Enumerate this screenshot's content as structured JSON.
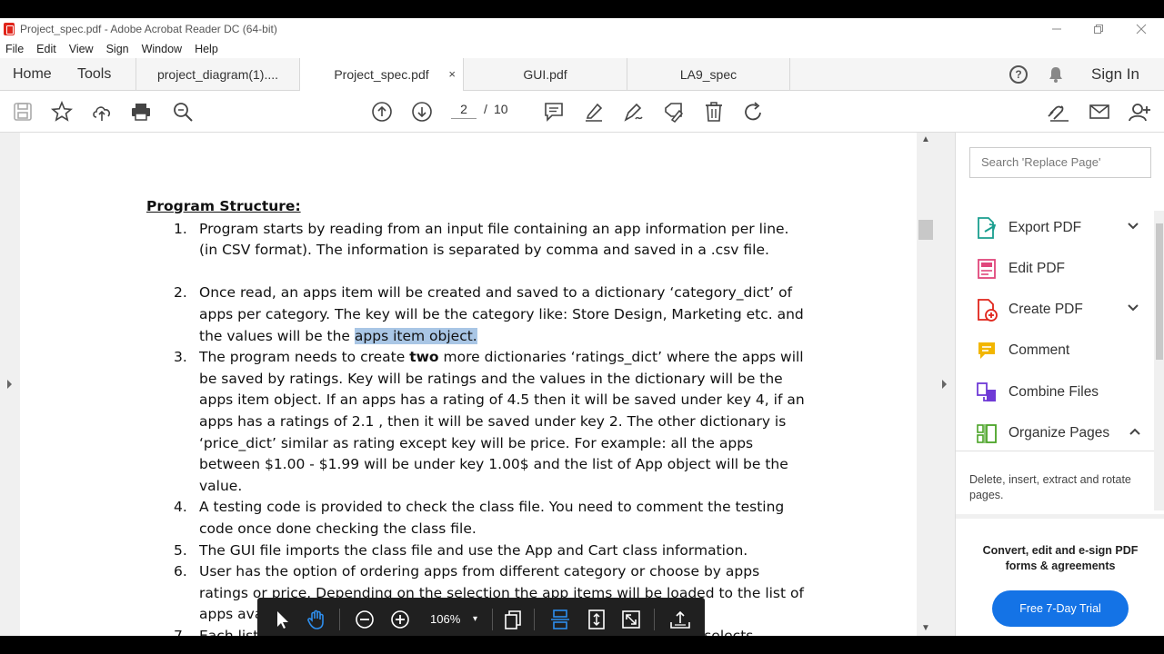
{
  "window": {
    "title": "Project_spec.pdf - Adobe Acrobat Reader DC (64-bit)",
    "controls": [
      "minimize",
      "restore",
      "close"
    ]
  },
  "menubar": [
    "File",
    "Edit",
    "View",
    "Sign",
    "Window",
    "Help"
  ],
  "nav": {
    "home": "Home",
    "tools": "Tools",
    "sign_in": "Sign In"
  },
  "tabs": [
    {
      "label": "project_diagram(1)....",
      "active": false
    },
    {
      "label": "Project_spec.pdf",
      "active": true,
      "close": "×"
    },
    {
      "label": "GUI.pdf",
      "active": false
    },
    {
      "label": "LA9_spec",
      "active": false
    }
  ],
  "toolbar": {
    "page_current": "2",
    "page_separator": "/",
    "page_total": "10",
    "icons": [
      "save-icon",
      "bookmark-star-icon",
      "upload-icon",
      "print-icon",
      "search-icon",
      "prev-page-icon",
      "next-page-icon",
      "comment-icon",
      "highlight-icon",
      "sign-icon",
      "fill-sign-icon",
      "delete-icon",
      "rotate-icon",
      "share-link-icon",
      "email-icon",
      "add-user-icon"
    ]
  },
  "document": {
    "heading": "Program Structure:",
    "items": [
      {
        "num": "1.",
        "lines": [
          "Program starts by reading from an input file containing an app information per line.",
          "(in CSV format). The information is separated by comma and saved in a .csv file."
        ]
      },
      {
        "num": "2.",
        "line1": "Once read, an apps item will be created and saved to a dictionary ‘category_dict’ of",
        "line2": "apps per category. The key will be the category like: Store Design, Marketing etc. and",
        "line3_pre": "the values will be the ",
        "line3_highlight": "apps item object."
      },
      {
        "num": "3.",
        "line1_pre": "The program needs to create ",
        "line1_bold": "two",
        "line1_post": " more dictionaries ‘ratings_dict’ where the apps will",
        "rest": [
          "be saved by ratings. Key will be ratings and the values in the dictionary will be the",
          "apps item object. If an apps has a rating of 4.5 then it will be saved under key 4, if an",
          "apps has a ratings of 2.1 , then it will be saved under key 2. The other dictionary is",
          "‘price_dict’ similar as rating except key will be price. For example: all the apps",
          "between $1.00 - $1.99 will be under key 1.00$ and the list of App object will be the",
          "value."
        ]
      },
      {
        "num": "4.",
        "lines": [
          "A testing code is provided to check the class file. You need to comment the testing",
          "code once done checking the class file."
        ]
      },
      {
        "num": "5.",
        "lines": [
          "The GUI file imports the class file and use the App and Cart class information."
        ]
      },
      {
        "num": "6.",
        "lines": [
          "User has the option of ordering apps from different category or choose by apps",
          "ratings or price. Depending on the selection the app items will be loaded to the list of",
          "apps available."
        ]
      },
      {
        "num": "7.",
        "lines": [
          "Each list, loads the items from the corresponding category_dict. If user selects"
        ]
      }
    ]
  },
  "float_toolbar": {
    "zoom": "106%",
    "zoom_arrow": "▾"
  },
  "right_pane": {
    "search_placeholder": "Search 'Replace Page'",
    "tools": [
      {
        "label": "Export PDF",
        "icon": "export-pdf-icon",
        "color": "#1a9e8f",
        "chevron": "down"
      },
      {
        "label": "Edit PDF",
        "icon": "edit-pdf-icon",
        "color": "#e0477b",
        "chevron": ""
      },
      {
        "label": "Create PDF",
        "icon": "create-pdf-icon",
        "color": "#e0251b",
        "chevron": "down"
      },
      {
        "label": "Comment",
        "icon": "comment-tool-icon",
        "color": "#f2b600",
        "chevron": ""
      },
      {
        "label": "Combine Files",
        "icon": "combine-files-icon",
        "color": "#6f3ad6",
        "chevron": ""
      },
      {
        "label": "Organize Pages",
        "icon": "organize-pages-icon",
        "color": "#4aa326",
        "chevron": "up"
      }
    ],
    "description": "Delete, insert, extract and rotate pages.",
    "promo": "Convert, edit and e-sign PDF forms & agreements",
    "trial_button": "Free 7-Day Trial"
  },
  "colors": {
    "accent_blue": "#1473e6",
    "highlight": "#a9c6e5",
    "float_bar": "#202020",
    "active_icon": "#2e8fef"
  }
}
